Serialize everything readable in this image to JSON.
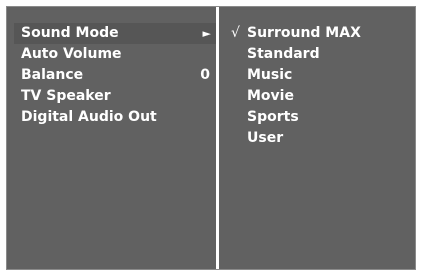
{
  "settings_menu": {
    "items": [
      {
        "label": "Sound Mode",
        "value": "",
        "indicator": "►",
        "selected": true
      },
      {
        "label": "Auto Volume",
        "value": "",
        "indicator": "",
        "selected": false
      },
      {
        "label": "Balance",
        "value": "0",
        "indicator": "",
        "selected": false
      },
      {
        "label": "TV Speaker",
        "value": "",
        "indicator": "",
        "selected": false
      },
      {
        "label": "Digital Audio Out",
        "value": "",
        "indicator": "",
        "selected": false
      }
    ]
  },
  "submenu": {
    "check_mark": "√",
    "options": [
      {
        "label": "Surround MAX",
        "checked": true
      },
      {
        "label": "Standard",
        "checked": false
      },
      {
        "label": "Music",
        "checked": false
      },
      {
        "label": "Movie",
        "checked": false
      },
      {
        "label": "Sports",
        "checked": false
      },
      {
        "label": "User",
        "checked": false
      }
    ]
  },
  "colors": {
    "panel_bg": "#616161",
    "selected_row_bg": "#565656",
    "divider": "#ffffff",
    "text": "#ffffff"
  }
}
